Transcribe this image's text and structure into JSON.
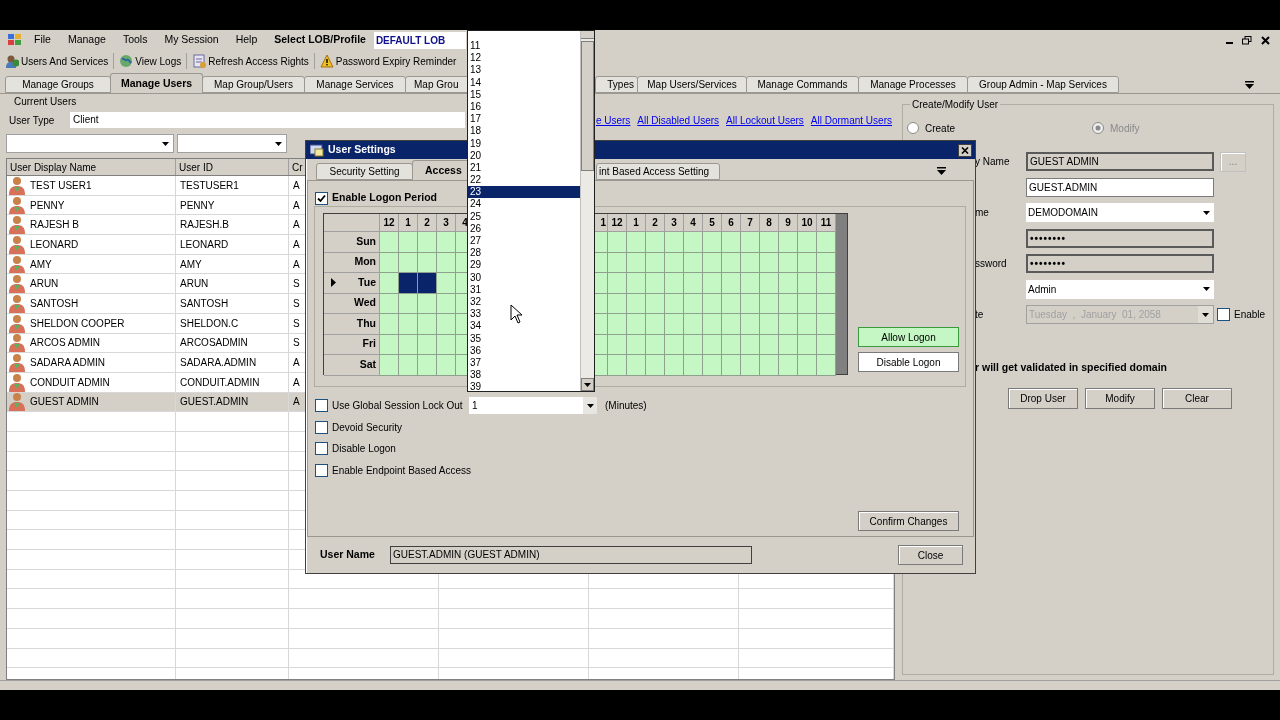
{
  "menu": {
    "items": [
      "File",
      "Manage",
      "Tools",
      "My Session",
      "Help"
    ],
    "lob_label": "Select LOB/Profile",
    "lob_value": "DEFAULT LOB"
  },
  "toolbar": [
    "Users And Services",
    "View Logs",
    "Refresh Access Rights",
    "Password Expiry Reminder"
  ],
  "tabs": [
    {
      "label": "Manage Groups",
      "selected": false
    },
    {
      "label": "Manage Users",
      "selected": true
    },
    {
      "label": "Map Group/Users",
      "selected": false
    },
    {
      "label": "Manage Services",
      "selected": false
    },
    {
      "label": "Map Grou",
      "selected": false
    },
    {
      "label": "Types",
      "selected": false
    },
    {
      "label": "Map Users/Services",
      "selected": false
    },
    {
      "label": "Manage Commands",
      "selected": false
    },
    {
      "label": "Manage Processes",
      "selected": false
    },
    {
      "label": "Group Admin - Map Services",
      "selected": false
    }
  ],
  "current_users": {
    "title": "Current Users",
    "user_type_label": "User Type",
    "user_type": "Client",
    "links": [
      "e Users",
      "All Disabled Users",
      "All Lockout Users",
      "All Dormant Users"
    ],
    "columns": [
      "User Display Name",
      "User ID",
      "Cr"
    ],
    "rows": [
      {
        "name": "TEST USER1",
        "id": "TESTUSER1",
        "column_3": "A",
        "selected": false
      },
      {
        "name": "PENNY",
        "id": "PENNY",
        "column_3": "A",
        "selected": false
      },
      {
        "name": "RAJESH B",
        "id": "RAJESH.B",
        "column_3": "A",
        "selected": false
      },
      {
        "name": "LEONARD",
        "id": "LEONARD",
        "column_3": "A",
        "selected": false
      },
      {
        "name": "AMY",
        "id": "AMY",
        "column_3": "A",
        "selected": false
      },
      {
        "name": "ARUN",
        "id": "ARUN",
        "column_3": "S",
        "selected": false
      },
      {
        "name": "SANTOSH",
        "id": "SANTOSH",
        "column_3": "S",
        "selected": false
      },
      {
        "name": "SHELDON COOPER",
        "id": "SHELDON.C",
        "column_3": "S",
        "selected": false
      },
      {
        "name": "ARCOS ADMIN",
        "id": "ARCOSADMIN",
        "column_3": "S",
        "selected": false
      },
      {
        "name": "SADARA ADMIN",
        "id": "SADARA.ADMIN",
        "column_3": "A",
        "selected": false
      },
      {
        "name": "CONDUIT ADMIN",
        "id": "CONDUIT.ADMIN",
        "column_3": "A",
        "selected": false
      },
      {
        "name": "GUEST ADMIN",
        "id": "GUEST.ADMIN",
        "column_3": "A",
        "selected": true
      }
    ]
  },
  "create_modify": {
    "title": "Create/Modify User",
    "modes": [
      {
        "label": "Create",
        "selected": false,
        "disabled": false
      },
      {
        "label": "Modify",
        "selected": true,
        "disabled": true
      }
    ],
    "fields": [
      {
        "label": "y Name",
        "kind": "readonly",
        "value": "GUEST ADMIN",
        "button": "..."
      },
      {
        "kind": "text",
        "value": "GUEST.ADMIN"
      },
      {
        "label": "me",
        "kind": "combo",
        "value": "DEMODOMAIN"
      },
      {
        "kind": "readonly",
        "value": "••••••••"
      },
      {
        "label": "ssword",
        "kind": "readonly",
        "value": "••••••••"
      },
      {
        "kind": "combo",
        "value": "Admin"
      },
      {
        "label": "te",
        "kind": "date",
        "disabled": true,
        "value": "Tuesday  ,  January  01, 2058",
        "checkbox": {
          "label": "Enable",
          "checked": false
        }
      }
    ],
    "note": "r will get validated in specified domain",
    "buttons": [
      "Drop User",
      "Modify",
      "Clear"
    ]
  },
  "dialog": {
    "title": "User Settings",
    "tabs": [
      {
        "label": "Security Setting",
        "selected": false
      },
      {
        "label": "Access",
        "selected": true
      },
      {
        "label": "int Based Access Setting",
        "selected": false
      }
    ],
    "logon_period": {
      "label": "Enable Logon Period",
      "checked": true
    },
    "hours": [
      "12",
      "1",
      "2",
      "3",
      "4",
      "1",
      "12",
      "1",
      "2",
      "3",
      "4",
      "5",
      "6",
      "7",
      "8",
      "9",
      "10",
      "11"
    ],
    "days": [
      {
        "label": "Sun",
        "current": false,
        "cells": [
          {
            "selected": false
          },
          {
            "selected": false
          },
          {
            "selected": false
          },
          {
            "selected": false
          },
          {
            "selected": false
          },
          {
            "selected": false
          },
          {
            "selected": false
          },
          {
            "selected": false
          },
          {
            "selected": false
          },
          {
            "selected": false
          },
          {
            "selected": false
          },
          {
            "selected": false
          },
          {
            "selected": false
          },
          {
            "selected": false
          },
          {
            "selected": false
          },
          {
            "selected": false
          },
          {
            "selected": false
          },
          {
            "selected": false
          }
        ]
      },
      {
        "label": "Mon",
        "current": false,
        "cells": [
          {
            "selected": false
          },
          {
            "selected": false
          },
          {
            "selected": false
          },
          {
            "selected": false
          },
          {
            "selected": false
          },
          {
            "selected": false
          },
          {
            "selected": false
          },
          {
            "selected": false
          },
          {
            "selected": false
          },
          {
            "selected": false
          },
          {
            "selected": false
          },
          {
            "selected": false
          },
          {
            "selected": false
          },
          {
            "selected": false
          },
          {
            "selected": false
          },
          {
            "selected": false
          },
          {
            "selected": false
          },
          {
            "selected": false
          }
        ]
      },
      {
        "label": "Tue",
        "current": true,
        "cells": [
          {
            "selected": false
          },
          {
            "selected": true
          },
          {
            "selected": true
          },
          {
            "selected": false
          },
          {
            "selected": false
          },
          {
            "selected": false
          },
          {
            "selected": false
          },
          {
            "selected": false
          },
          {
            "selected": false
          },
          {
            "selected": false
          },
          {
            "selected": false
          },
          {
            "selected": false
          },
          {
            "selected": false
          },
          {
            "selected": false
          },
          {
            "selected": false
          },
          {
            "selected": false
          },
          {
            "selected": false
          },
          {
            "selected": false
          }
        ]
      },
      {
        "label": "Wed",
        "current": false,
        "cells": [
          {
            "selected": false
          },
          {
            "selected": false
          },
          {
            "selected": false
          },
          {
            "selected": false
          },
          {
            "selected": false
          },
          {
            "selected": false
          },
          {
            "selected": false
          },
          {
            "selected": false
          },
          {
            "selected": false
          },
          {
            "selected": false
          },
          {
            "selected": false
          },
          {
            "selected": false
          },
          {
            "selected": false
          },
          {
            "selected": false
          },
          {
            "selected": false
          },
          {
            "selected": false
          },
          {
            "selected": false
          },
          {
            "selected": false
          }
        ]
      },
      {
        "label": "Thu",
        "current": false,
        "cells": [
          {
            "selected": false
          },
          {
            "selected": false
          },
          {
            "selected": false
          },
          {
            "selected": false
          },
          {
            "selected": false
          },
          {
            "selected": false
          },
          {
            "selected": false
          },
          {
            "selected": false
          },
          {
            "selected": false
          },
          {
            "selected": false
          },
          {
            "selected": false
          },
          {
            "selected": false
          },
          {
            "selected": false
          },
          {
            "selected": false
          },
          {
            "selected": false
          },
          {
            "selected": false
          },
          {
            "selected": false
          },
          {
            "selected": false
          }
        ]
      },
      {
        "label": "Fri",
        "current": false,
        "cells": [
          {
            "selected": false
          },
          {
            "selected": false
          },
          {
            "selected": false
          },
          {
            "selected": false
          },
          {
            "selected": false
          },
          {
            "selected": false
          },
          {
            "selected": false
          },
          {
            "selected": false
          },
          {
            "selected": false
          },
          {
            "selected": false
          },
          {
            "selected": false
          },
          {
            "selected": false
          },
          {
            "selected": false
          },
          {
            "selected": false
          },
          {
            "selected": false
          },
          {
            "selected": false
          },
          {
            "selected": false
          },
          {
            "selected": false
          }
        ]
      },
      {
        "label": "Sat",
        "current": false,
        "cells": [
          {
            "selected": false
          },
          {
            "selected": false
          },
          {
            "selected": false
          },
          {
            "selected": false
          },
          {
            "selected": false
          },
          {
            "selected": false
          },
          {
            "selected": false
          },
          {
            "selected": false
          },
          {
            "selected": false
          },
          {
            "selected": false
          },
          {
            "selected": false
          },
          {
            "selected": false
          },
          {
            "selected": false
          },
          {
            "selected": false
          },
          {
            "selected": false
          },
          {
            "selected": false
          },
          {
            "selected": false
          },
          {
            "selected": false
          }
        ]
      }
    ],
    "actions": [
      {
        "label": "Allow Logon",
        "kind": "allow"
      },
      {
        "label": "Disable Logon",
        "kind": "disable"
      }
    ],
    "options": [
      {
        "label": "Use Global Session Lock Out",
        "checked": false
      },
      {
        "label": "Devoid Security",
        "checked": false
      },
      {
        "label": "Disable Logon",
        "checked": false
      },
      {
        "label": "Enable Endpoint Based Access",
        "checked": false
      }
    ],
    "lock_out": {
      "value": "1",
      "unit": "(Minutes)"
    },
    "confirm": "Confirm Changes",
    "user_name_label": "User Name",
    "user_name": "GUEST.ADMIN (GUEST ADMIN)",
    "close": "Close"
  },
  "dropdown": {
    "items": [
      {
        "label": "11",
        "selected": false
      },
      {
        "label": "12",
        "selected": false
      },
      {
        "label": "13",
        "selected": false
      },
      {
        "label": "14",
        "selected": false
      },
      {
        "label": "15",
        "selected": false
      },
      {
        "label": "16",
        "selected": false
      },
      {
        "label": "17",
        "selected": false
      },
      {
        "label": "18",
        "selected": false
      },
      {
        "label": "19",
        "selected": false
      },
      {
        "label": "20",
        "selected": false
      },
      {
        "label": "21",
        "selected": false
      },
      {
        "label": "22",
        "selected": false
      },
      {
        "label": "23",
        "selected": true
      },
      {
        "label": "24",
        "selected": false
      },
      {
        "label": "25",
        "selected": false
      },
      {
        "label": "26",
        "selected": false
      },
      {
        "label": "27",
        "selected": false
      },
      {
        "label": "28",
        "selected": false
      },
      {
        "label": "29",
        "selected": false
      },
      {
        "label": "30",
        "selected": false
      },
      {
        "label": "31",
        "selected": false
      },
      {
        "label": "32",
        "selected": false
      },
      {
        "label": "33",
        "selected": false
      },
      {
        "label": "34",
        "selected": false
      },
      {
        "label": "35",
        "selected": false
      },
      {
        "label": "36",
        "selected": false
      },
      {
        "label": "37",
        "selected": false
      },
      {
        "label": "38",
        "selected": false
      },
      {
        "label": "39",
        "selected": false
      }
    ]
  }
}
